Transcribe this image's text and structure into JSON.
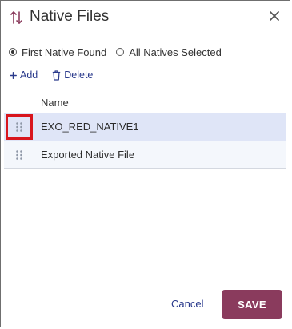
{
  "dialog": {
    "title": "Native Files",
    "icons": {
      "title": "sort-arrows-icon",
      "close": "close-icon"
    }
  },
  "options": {
    "first_native": {
      "label": "First Native Found",
      "checked": true
    },
    "all_natives": {
      "label": "All Natives Selected",
      "checked": false
    }
  },
  "toolbar": {
    "add_label": "Add",
    "delete_label": "Delete",
    "icons": {
      "add": "plus-icon",
      "delete": "trash-icon"
    }
  },
  "table": {
    "columns": [
      "Name"
    ],
    "rows": [
      {
        "name": "EXO_RED_NATIVE1",
        "selected": true
      },
      {
        "name": "Exported Native File",
        "selected": false
      }
    ]
  },
  "footer": {
    "cancel_label": "Cancel",
    "save_label": "SAVE"
  },
  "colors": {
    "accent": "#8a3b5d",
    "link": "#2a3a8c",
    "selected_row": "#dfe5f7",
    "highlight_box": "#d8151d"
  }
}
